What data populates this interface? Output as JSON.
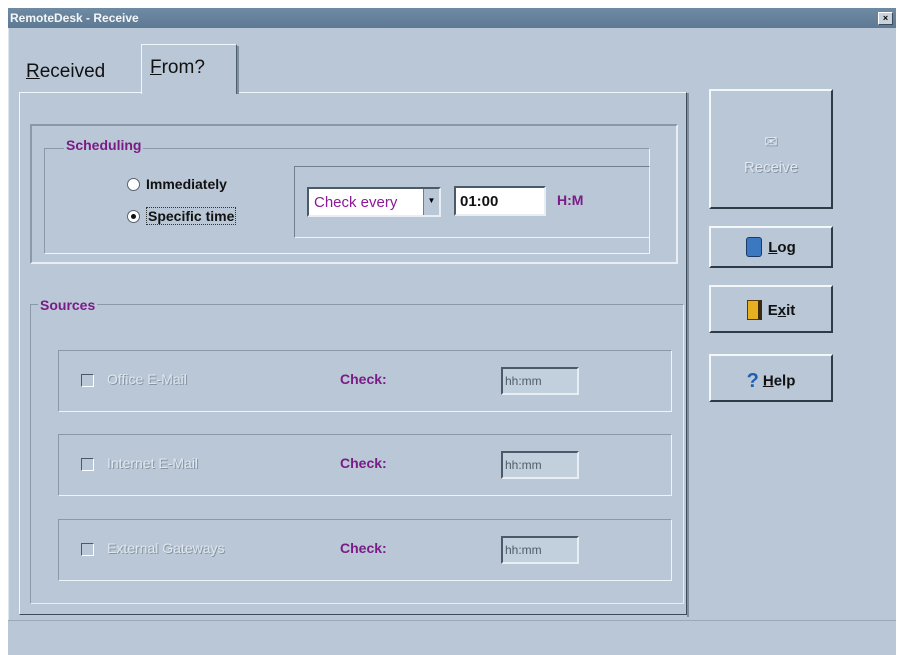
{
  "window": {
    "title": "RemoteDesk - Receive",
    "close_glyph": "×"
  },
  "tabs": [
    {
      "label_mnemonic": "R",
      "label_rest": "eceived"
    },
    {
      "label_mnemonic": "F",
      "label_rest": "rom?"
    }
  ],
  "scheduling": {
    "group_label": "Scheduling",
    "option_immediately": "Immediately",
    "option_specific": "Specific time",
    "selected_option": "Specific time",
    "frequency_value": "Check every",
    "time_value": "01:00",
    "time_unit": "H:M"
  },
  "sources": {
    "group_label": "Sources",
    "items": [
      {
        "name": "Office E-Mail",
        "check_label": "Check:",
        "time_value": "hh:mm",
        "checked": false
      },
      {
        "name": "Internet E-Mail",
        "check_label": "Check:",
        "time_value": "hh:mm",
        "checked": false
      },
      {
        "name": "External Gateways",
        "check_label": "Check:",
        "time_value": "hh:mm",
        "checked": false
      }
    ]
  },
  "buttons": {
    "receive": {
      "label": "Receive",
      "enabled": false,
      "icon": "receive-icon"
    },
    "log": {
      "mnemonic": "L",
      "rest": "og",
      "icon": "log-icon"
    },
    "exit": {
      "pre": "E",
      "mnemonic": "x",
      "rest": "it",
      "icon": "exit-icon"
    },
    "help": {
      "mnemonic": "H",
      "rest": "elp",
      "icon": "help-icon"
    }
  },
  "colors": {
    "accent": "#7b1c86",
    "window_bg": "#b9c7d6",
    "titlebar": "#5e7993"
  }
}
